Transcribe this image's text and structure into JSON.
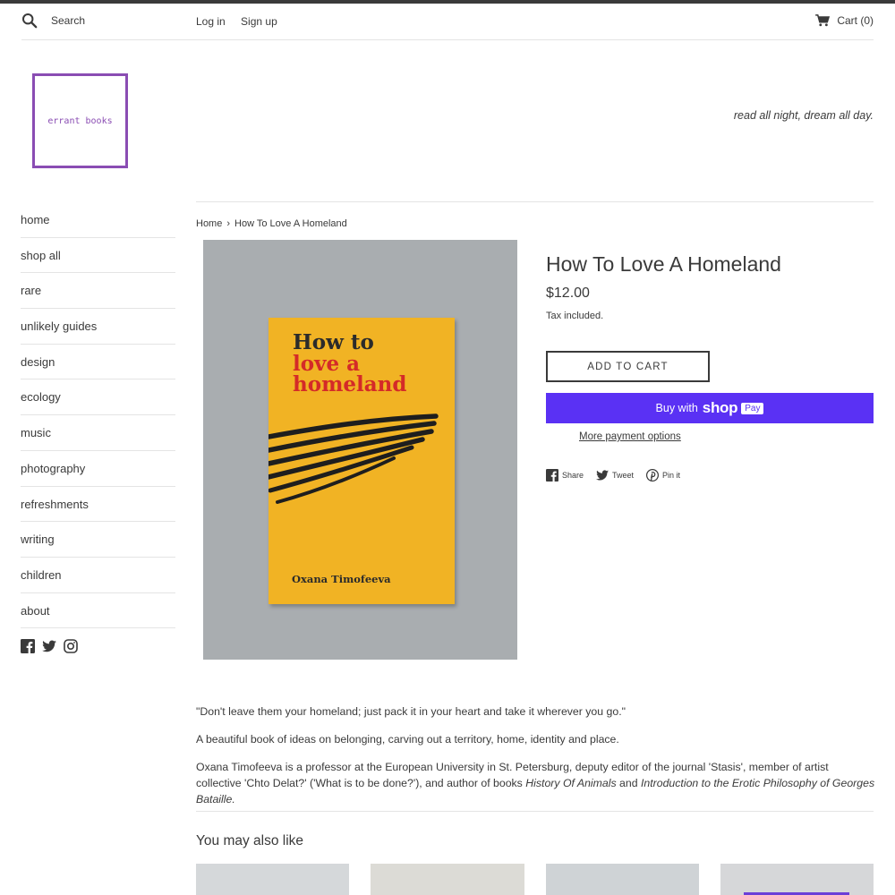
{
  "header": {
    "search_placeholder": "Search",
    "login": "Log in",
    "signup": "Sign up",
    "cart": "Cart (0)"
  },
  "logo_text": "errant books",
  "tagline": "read all night, dream all day.",
  "nav": [
    "home",
    "shop all",
    "rare",
    "unlikely guides",
    "design",
    "ecology",
    "music",
    "photography",
    "refreshments",
    "writing",
    "children",
    "about"
  ],
  "breadcrumb": {
    "home": "Home",
    "separator": "›",
    "current": "How To Love A Homeland"
  },
  "book_cover": {
    "title_line1": "How to",
    "title_line2": "love a",
    "title_line3": "homeland",
    "author": "Oxana Timofeeva"
  },
  "product": {
    "title": "How To Love A Homeland",
    "price": "$12.00",
    "tax_note": "Tax included.",
    "add_to_cart": "ADD TO CART",
    "buy_with": "Buy with",
    "shop_word": "shop",
    "pay_badge": "Pay",
    "more_payment": "More payment options"
  },
  "share": {
    "facebook": "Share",
    "twitter": "Tweet",
    "pinterest": "Pin it"
  },
  "description": {
    "quote": "\"Don't leave them your homeland; just pack it in your heart and take it wherever you go.\"",
    "summary": "A beautiful book of ideas on belonging, carving out a territory, home, identity and place.",
    "bio_start": "Oxana Timofeeva is a professor at the European University in St. Petersburg, deputy editor of the journal 'Stasis', member of artist collective 'Chto Delat?' ('What is to be done?'), and author of books ",
    "bio_book1": "History Of Animals",
    "bio_and": " and ",
    "bio_book2": "Introduction to the Erotic Philosophy of Georges Bataille."
  },
  "related": {
    "heading": "You may also like"
  },
  "colors": {
    "accent_purple": "#8a4db3",
    "shop_pay": "#5a31f4",
    "text": "#3a3a3a"
  }
}
